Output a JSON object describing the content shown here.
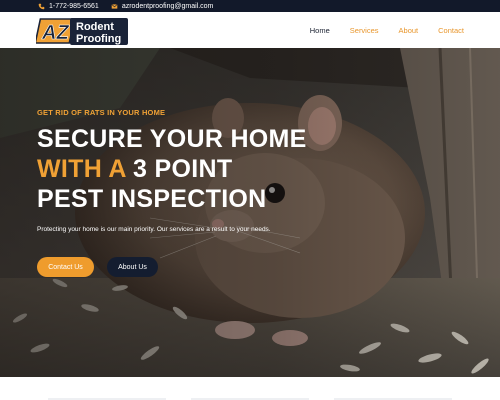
{
  "topbar": {
    "phone": "1-772-985-6561",
    "phone_icon": "phone-icon",
    "email": "azrodentproofing@gmail.com",
    "email_icon": "envelope-icon"
  },
  "logo": {
    "mark": "AZ",
    "line1": "Rodent",
    "line2": "Proofing"
  },
  "nav": {
    "items": [
      {
        "label": "Home",
        "active": true
      },
      {
        "label": "Services",
        "active": false
      },
      {
        "label": "About",
        "active": false
      },
      {
        "label": "Contact",
        "active": false
      }
    ]
  },
  "hero": {
    "eyebrow": "GET RID OF RATS IN YOUR HOME",
    "headline_line1": "SECURE YOUR HOME",
    "headline_accent": "WITH A",
    "headline_line2_rest": " 3 POINT",
    "headline_line3": "PEST INSPECTION",
    "tagline": "Protecting your home is our main priority. Our services are a result to your needs.",
    "primary_button": "Contact Us",
    "secondary_button": "About Us"
  },
  "colors": {
    "accent": "#f0a135",
    "dark": "#12192a"
  }
}
